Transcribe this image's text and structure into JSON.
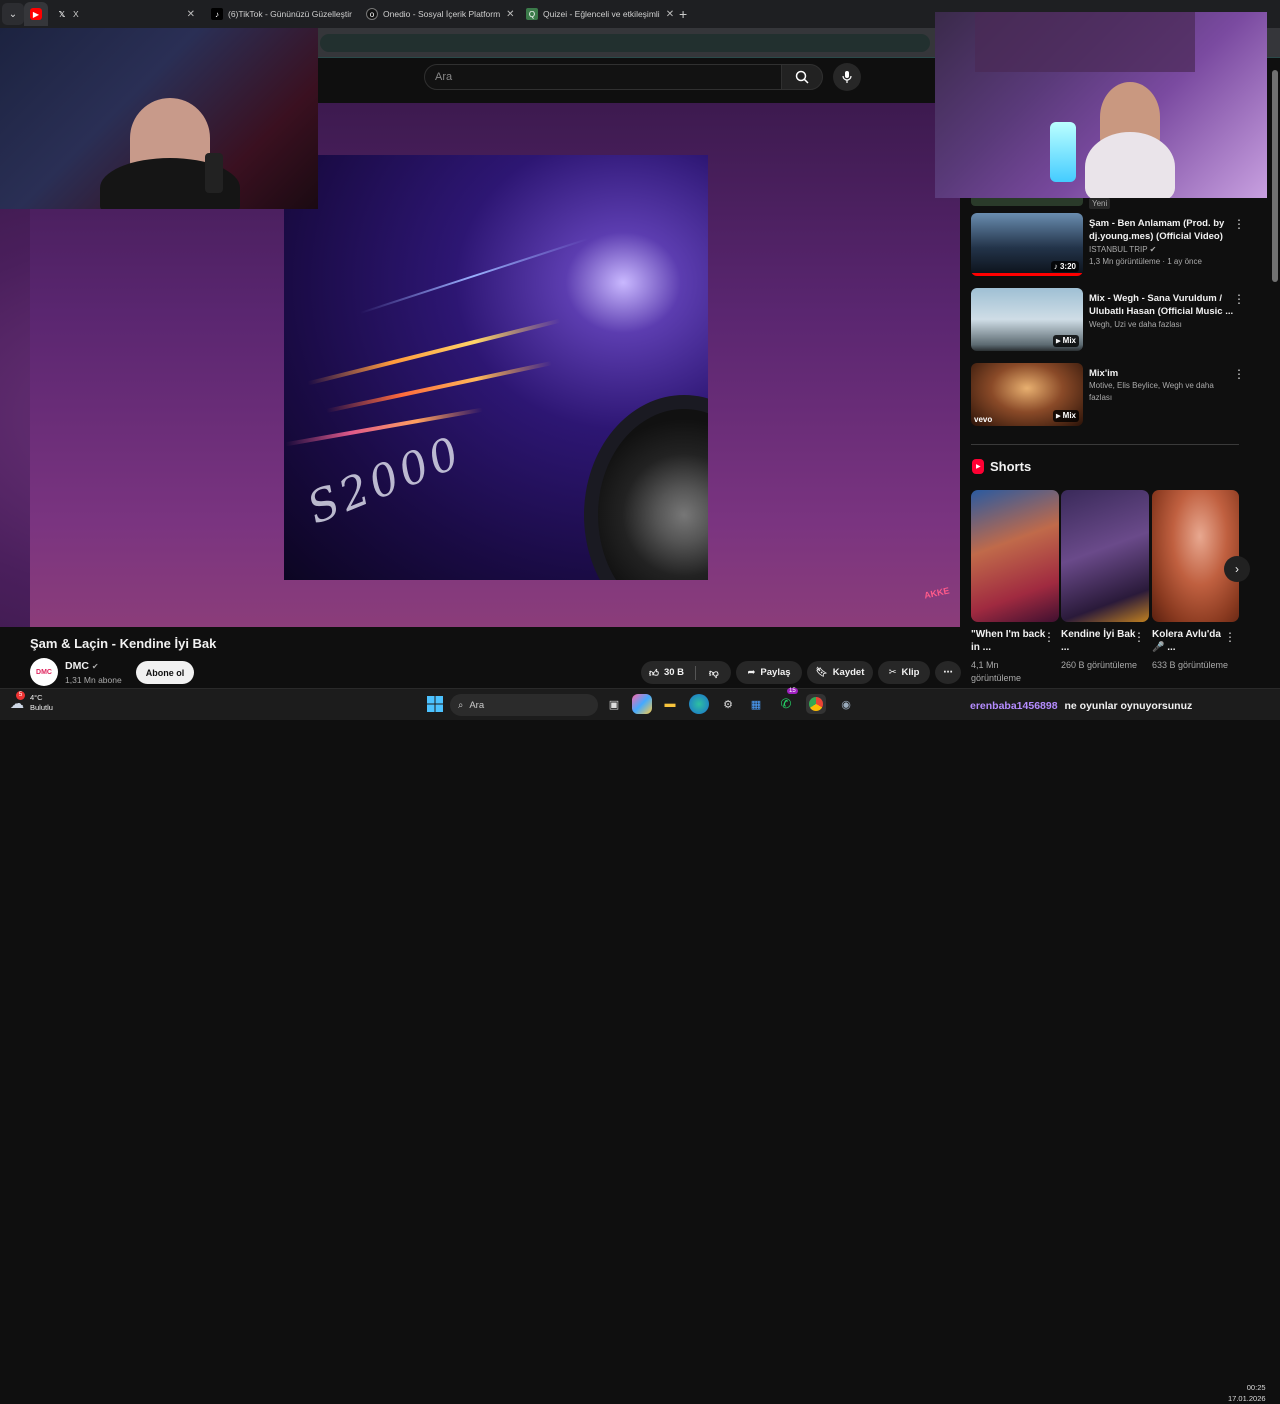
{
  "browser": {
    "tabs": [
      {
        "label": "",
        "icon": "youtube-icon",
        "active": true
      },
      {
        "label": "X",
        "icon": "x-icon"
      },
      {
        "label": "(6)TikTok - Gününüzü Güzelleştir",
        "icon": "tiktok-icon"
      },
      {
        "label": "Onedio - Sosyal İçerik Platform",
        "icon": "onedio-icon"
      },
      {
        "label": "Quizei - Eğlenceli ve etkileşimli",
        "icon": "quizei-icon"
      }
    ]
  },
  "search": {
    "placeholder": "Ara"
  },
  "video": {
    "title": "Şam & Laçin - Kendine İyi Bak",
    "channel": "DMC",
    "subscribers": "1,31 Mn abone",
    "subscribe_label": "Abone ol",
    "likes": "30 B",
    "share_label": "Paylaş",
    "save_label": "Kaydet",
    "clip_label": "Klip",
    "watermark": "AKKE"
  },
  "sidebar": {
    "new_badge": "Yeni",
    "recommendations": [
      {
        "title": "Şam - Ben Anlamam (Prod. by dj.young.mes) (Official Video)",
        "channel": "ISTANBUL TRIP",
        "meta": "1,3 Mn görüntüleme · 1 ay önce",
        "badge": "3:20"
      },
      {
        "title": "Mix - Wegh - Sana Vuruldum / Ulubatlı Hasan (Official Music ...",
        "channel": "Wegh, Uzi ve daha fazlası",
        "meta": "",
        "badge": "Mix"
      },
      {
        "title": "Mix'im",
        "channel": "Motive, Elis Beylice, Wegh ve daha fazlası",
        "meta": "",
        "badge": "Mix",
        "thumb_label": "vevo"
      }
    ],
    "shorts_heading": "Shorts",
    "shorts": [
      {
        "title": "\"When I'm back in ...",
        "views": "4,1 Mn görüntüleme"
      },
      {
        "title": "Kendine İyi Bak ...",
        "views": "260 B görüntüleme"
      },
      {
        "title": "Kolera Avlu'da 🎤 ...",
        "views": "633 B görüntüleme"
      }
    ]
  },
  "taskbar": {
    "temperature": "4°C",
    "weather": "Bulutlu",
    "search_placeholder": "Ara",
    "whatsapp_badge": "15",
    "weather_badge": "5",
    "time": "00:25",
    "date": "17.01.2026"
  },
  "chat": {
    "user": "erenbaba1456898",
    "message": "ne oyunlar oynuyorsunuz"
  }
}
